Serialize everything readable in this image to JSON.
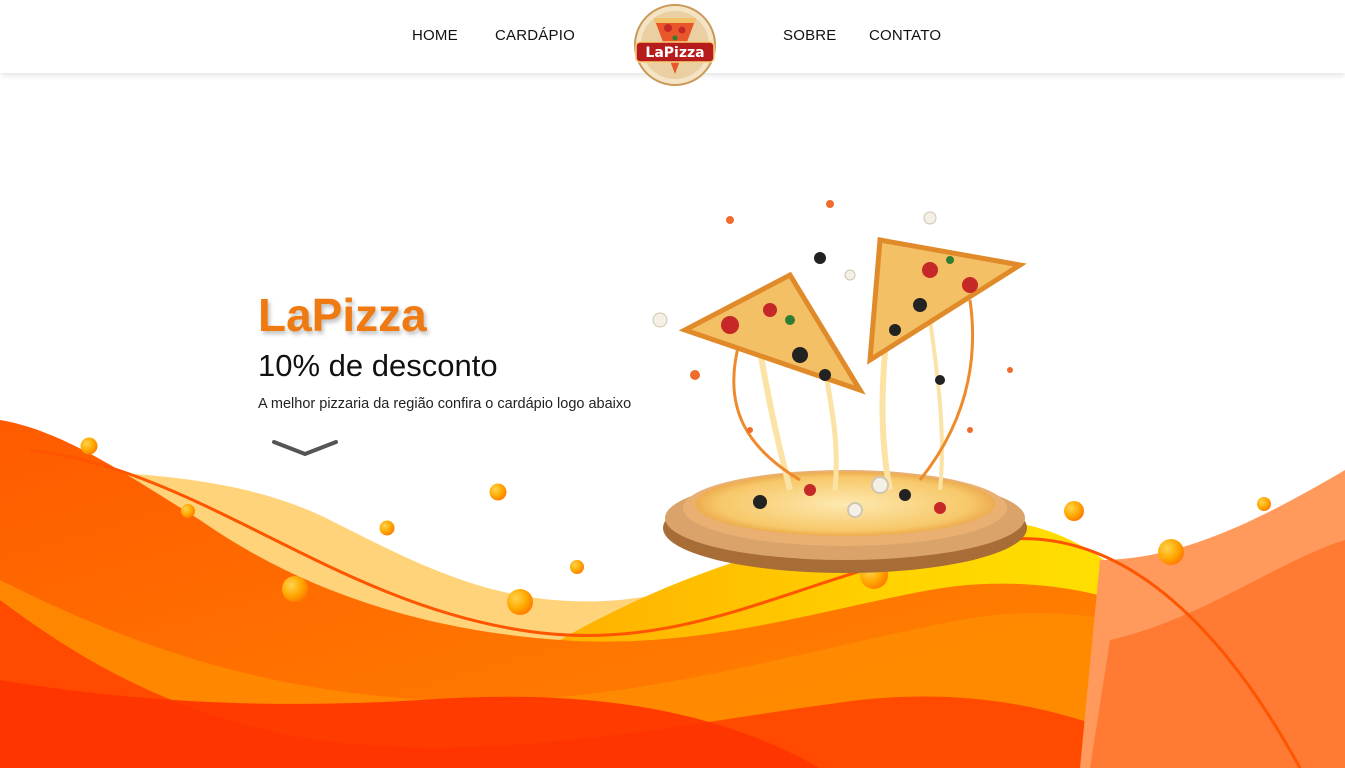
{
  "nav": {
    "links": [
      "HOME",
      "CARDÁPIO",
      "SOBRE",
      "CONTATO"
    ],
    "logo_text": "LaPizza"
  },
  "hero": {
    "title": "LaPizza",
    "subtitle": "10% de desconto",
    "description": "A melhor pizzaria da região confira o cardápio logo abaixo"
  },
  "colors": {
    "accent_orange": "#f07a12",
    "wave_red": "#ff3d00",
    "wave_orange": "#ff7a00",
    "wave_yellow": "#ffd200"
  }
}
